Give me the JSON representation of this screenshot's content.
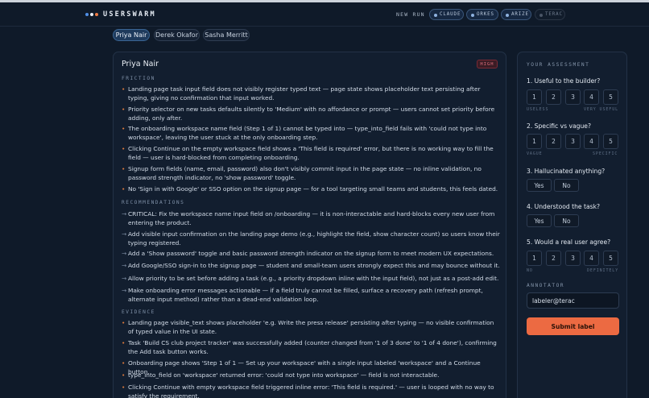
{
  "app": {
    "name": "USERSWARM",
    "logo_dots": [
      "#4f8fe6",
      "#e8eef6",
      "#ef7b45"
    ]
  },
  "header": {
    "new_run": "NEW RUN",
    "chips": [
      {
        "label": "CLAUDE",
        "active": true
      },
      {
        "label": "ORKES",
        "active": true
      },
      {
        "label": "ARIZE",
        "active": true
      },
      {
        "label": "TERAC",
        "active": false
      }
    ]
  },
  "personas": [
    {
      "name": "Priya Nair",
      "active": true
    },
    {
      "name": "Derek Okafor",
      "active": false
    },
    {
      "name": "Sasha Merritt",
      "active": false
    }
  ],
  "report": {
    "persona_name": "Priya Nair",
    "severity": "HIGH",
    "friction_label": "FRICTION",
    "friction": [
      "Landing page task input field does not visibly register typed text — page state shows placeholder text persisting after typing, giving no confirmation that input worked.",
      "Priority selector on new tasks defaults silently to 'Medium' with no affordance or prompt — users cannot set priority before adding, only after.",
      "The onboarding workspace name field (Step 1 of 1) cannot be typed into — type_into_field fails with 'could not type into workspace', leaving the user stuck at the only onboarding step.",
      "Clicking Continue on the empty workspace field shows a 'This field is required' error, but there is no working way to fill the field — user is hard-blocked from completing onboarding.",
      "Signup form fields (name, email, password) also don't visibly commit input in the page state — no inline validation, no password strength indicator, no 'show password' toggle.",
      "No 'Sign in with Google' or SSO option on the signup page — for a tool targeting small teams and students, this feels dated."
    ],
    "recommendations_label": "RECOMMENDATIONS",
    "recommendations": [
      "CRITICAL: Fix the workspace name input field on /onboarding — it is non-interactable and hard-blocks every new user from entering the product.",
      "Add visible input confirmation on the landing page demo (e.g., highlight the field, show character count) so users know their typing registered.",
      "Add a 'Show password' toggle and basic password strength indicator on the signup form to meet modern UX expectations.",
      "Add Google/SSO sign-in to the signup page — student and small-team users strongly expect this and may bounce without it.",
      "Allow priority to be set before adding a task (e.g., a priority dropdown inline with the input field), not just as a post-add edit.",
      "Make onboarding error messages actionable — if a field truly cannot be filled, surface a recovery path (refresh prompt, alternate input method) rather than a dead-end validation loop."
    ],
    "evidence_label": "EVIDENCE",
    "evidence": [
      "Landing page visible_text shows placeholder 'e.g. Write the press release' persisting after typing — no visible confirmation of typed value in the UI state.",
      "Task 'Build CS club project tracker' was successfully added (counter changed from '1 of 3 done' to '1 of 4 done'), confirming the Add task button works.",
      "Onboarding page shows 'Step 1 of 1 — Set up your workspace' with a single input labeled 'workspace' and a Continue button.",
      "type_into_field on 'workspace' returned error: 'could not type into workspace' — field is not interactable.",
      "Clicking Continue with empty workspace field triggered inline error: 'This field is required.' — user is looped with no way to satisfy the requirement."
    ]
  },
  "assessment": {
    "heading": "YOUR ASSESSMENT",
    "q1": {
      "text": "1. Useful to the builder?",
      "options": [
        "1",
        "2",
        "3",
        "4",
        "5"
      ],
      "low": "USELESS",
      "high": "VERY USEFUL"
    },
    "q2": {
      "text": "2. Specific vs vague?",
      "options": [
        "1",
        "2",
        "3",
        "4",
        "5"
      ],
      "low": "VAGUE",
      "high": "SPECIFIC"
    },
    "q3": {
      "text": "3. Hallucinated anything?",
      "yes": "Yes",
      "no": "No"
    },
    "q4": {
      "text": "4. Understood the task?",
      "yes": "Yes",
      "no": "No"
    },
    "q5": {
      "text": "5. Would a real user agree?",
      "options": [
        "1",
        "2",
        "3",
        "4",
        "5"
      ],
      "low": "NO",
      "high": "DEFINITELY"
    },
    "annotator_label": "ANNOTATOR",
    "annotator_value": "labeler@terac",
    "submit_label": "Submit label"
  },
  "colors": {
    "accent": "#ec6a42",
    "background": "#0f1a29",
    "severity_high": "#e0707c"
  }
}
